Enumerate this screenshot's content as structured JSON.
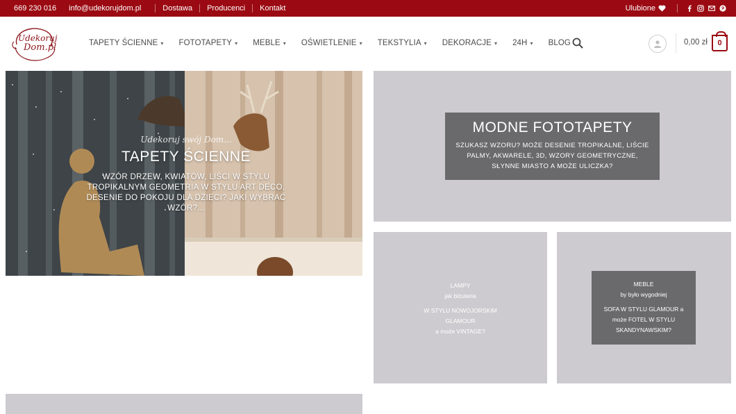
{
  "topbar": {
    "phone": "669 230 016",
    "email": "info@udekorujdom.pl",
    "links": [
      "Dostawa",
      "Producenci",
      "Kontakt"
    ],
    "favorites": "Ulubione",
    "social_icons": [
      "facebook-icon",
      "instagram-icon",
      "mail-icon",
      "pinterest-icon"
    ],
    "bg_color": "#9b0a12"
  },
  "logo": {
    "line1": "Udekoruj",
    "line2": "Dom.pl"
  },
  "nav": {
    "items": [
      {
        "label": "TAPETY ŚCIENNE",
        "dropdown": true
      },
      {
        "label": "FOTOTAPETY",
        "dropdown": true
      },
      {
        "label": "MEBLE",
        "dropdown": true
      },
      {
        "label": "OŚWIETLENIE",
        "dropdown": true
      },
      {
        "label": "TEKSTYLIA",
        "dropdown": true
      },
      {
        "label": "DEKORACJE",
        "dropdown": true
      },
      {
        "label": "24H",
        "dropdown": true
      },
      {
        "label": "BLOG",
        "dropdown": false
      }
    ]
  },
  "cart": {
    "price": "0,00 zł",
    "count": "0"
  },
  "hero": {
    "script": "Udekoruj swój Dom...",
    "title": "TAPETY ŚCIENNE",
    "desc_lines": [
      "WZÓR DRZEW, KWIATÓW, LIŚCI W STYLU",
      "TROPIKALNYM GEOMETRIA W STYLU ART DECO,",
      "DESENIE DO POKOJU DLA DZIECI? JAKI WYBRAĆ",
      "WZÓR?..."
    ]
  },
  "fototapety": {
    "title": "MODNE FOTOTAPETY",
    "desc": "SZUKASZ WZORU? MOŻE DESENIE TROPIKALNE, LIŚCIE PALMY, AKWARELE, 3D, WZORY GEOMETRYCZNE, SŁYNNE MIASTO A MOŻE ULICZKA?"
  },
  "lampy": {
    "lines": [
      "LAMPY",
      "jak biżuteria",
      "",
      "W STYLU NOWOJORSKIM",
      "GLAMOUR",
      "a może VINTAGE?"
    ]
  },
  "meble": {
    "lines": [
      "MEBLE",
      "by było wygodniej",
      "",
      "SOFA W STYLU GLAMOUR a",
      "może FOTEL W STYLU",
      "SKANDYNAWSKIM?"
    ]
  }
}
